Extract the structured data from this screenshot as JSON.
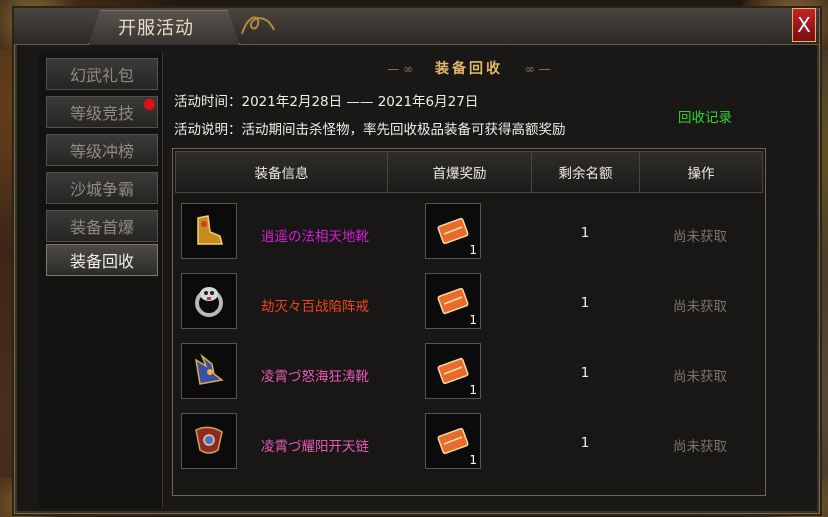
{
  "window": {
    "title": "开服活动",
    "close_label": "X"
  },
  "sidebar": {
    "items": [
      {
        "label": "幻武礼包",
        "active": false,
        "dot": false
      },
      {
        "label": "等级竞技",
        "active": false,
        "dot": true
      },
      {
        "label": "等级冲榜",
        "active": false,
        "dot": false
      },
      {
        "label": "沙城争霸",
        "active": false,
        "dot": false
      },
      {
        "label": "装备首爆",
        "active": false,
        "dot": false
      },
      {
        "label": "装备回收",
        "active": true,
        "dot": false
      }
    ]
  },
  "panel": {
    "heading": "装备回收",
    "heading_orn_left": "— ∞",
    "heading_orn_right": "∞ —",
    "time_text": "活动时间：2021年2月28日 —— 2021年6月27日",
    "desc_text": "活动说明：活动期间击杀怪物，率先回收极品装备可获得高额奖励",
    "record_link": "回收记录"
  },
  "table": {
    "headers": [
      "装备信息",
      "首爆奖励",
      "剩余名额",
      "操作"
    ],
    "rows": [
      {
        "name": "逍遥の法相天地靴",
        "name_color": "#d21ed2",
        "icon": "golden-boots-icon",
        "reward_icon": "scroll-reward-icon",
        "reward_qty": "1",
        "remaining": "1",
        "action": "尚未获取"
      },
      {
        "name": "劫灭々百战陷阵戒",
        "name_color": "#f0451e",
        "icon": "skull-ring-icon",
        "reward_icon": "scroll-reward-icon",
        "reward_qty": "1",
        "remaining": "1",
        "action": "尚未获取"
      },
      {
        "name": "凌霄づ怒海狂涛靴",
        "name_color": "#e85bb4",
        "icon": "winged-boots-icon",
        "reward_icon": "scroll-reward-icon",
        "reward_qty": "1",
        "remaining": "1",
        "action": "尚未获取"
      },
      {
        "name": "凌霄づ耀阳开天链",
        "name_color": "#e85bb4",
        "icon": "amulet-necklace-icon",
        "reward_icon": "scroll-reward-icon",
        "reward_qty": "1",
        "remaining": "1",
        "action": "尚未获取"
      }
    ]
  },
  "colors": {
    "action_disabled": "#7c7466",
    "accent_gold": "#e2b86b",
    "record_green": "#33d22d"
  }
}
